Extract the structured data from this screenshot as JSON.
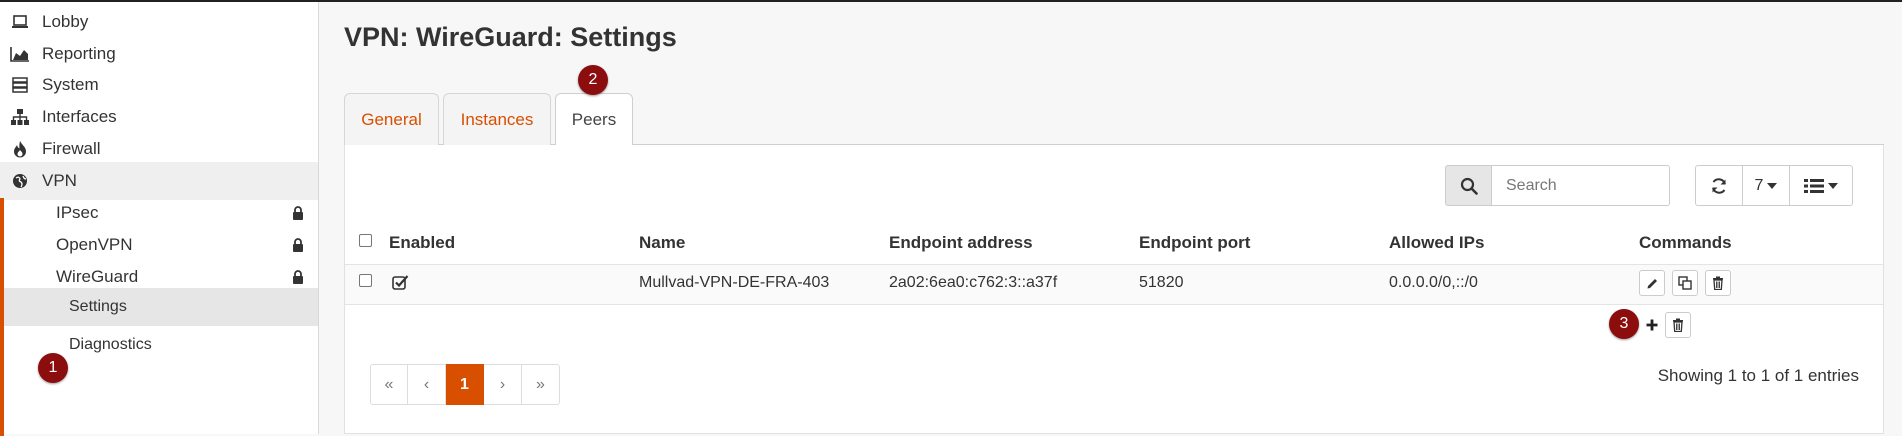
{
  "sidebar": {
    "items": [
      {
        "label": "Lobby",
        "icon": "laptop-icon"
      },
      {
        "label": "Reporting",
        "icon": "area-chart-icon"
      },
      {
        "label": "System",
        "icon": "server-icon"
      },
      {
        "label": "Interfaces",
        "icon": "sitemap-icon"
      },
      {
        "label": "Firewall",
        "icon": "fire-icon"
      },
      {
        "label": "VPN",
        "icon": "globe-icon"
      }
    ],
    "vpn_children": [
      {
        "label": "IPsec",
        "icon": "lock-icon"
      },
      {
        "label": "OpenVPN",
        "icon": "lock-icon"
      },
      {
        "label": "WireGuard",
        "icon": "lock-icon"
      }
    ],
    "wireguard_children": [
      {
        "label": "Settings"
      },
      {
        "label": "Diagnostics"
      }
    ]
  },
  "page": {
    "title": "VPN: WireGuard: Settings"
  },
  "tabs": [
    {
      "label": "General"
    },
    {
      "label": "Instances"
    },
    {
      "label": "Peers",
      "active": true
    }
  ],
  "toolbar": {
    "search_placeholder": "Search",
    "row_count": "7"
  },
  "table": {
    "headers": [
      "Enabled",
      "Name",
      "Endpoint address",
      "Endpoint port",
      "Allowed IPs",
      "Commands"
    ],
    "rows": [
      {
        "enabled": true,
        "name": "Mullvad-VPN-DE-FRA-403",
        "endpoint_address": "2a02:6ea0:c762:3::a37f",
        "endpoint_port": "51820",
        "allowed_ips": "0.0.0.0/0,::/0"
      }
    ]
  },
  "pagination": {
    "first": "«",
    "prev": "‹",
    "current": "1",
    "next": "›",
    "last": "»",
    "summary": "Showing 1 to 1 of 1 entries"
  },
  "annotations": [
    "1",
    "2",
    "3"
  ],
  "colors": {
    "accent": "#d94f00",
    "badge": "#8b0d0d"
  }
}
